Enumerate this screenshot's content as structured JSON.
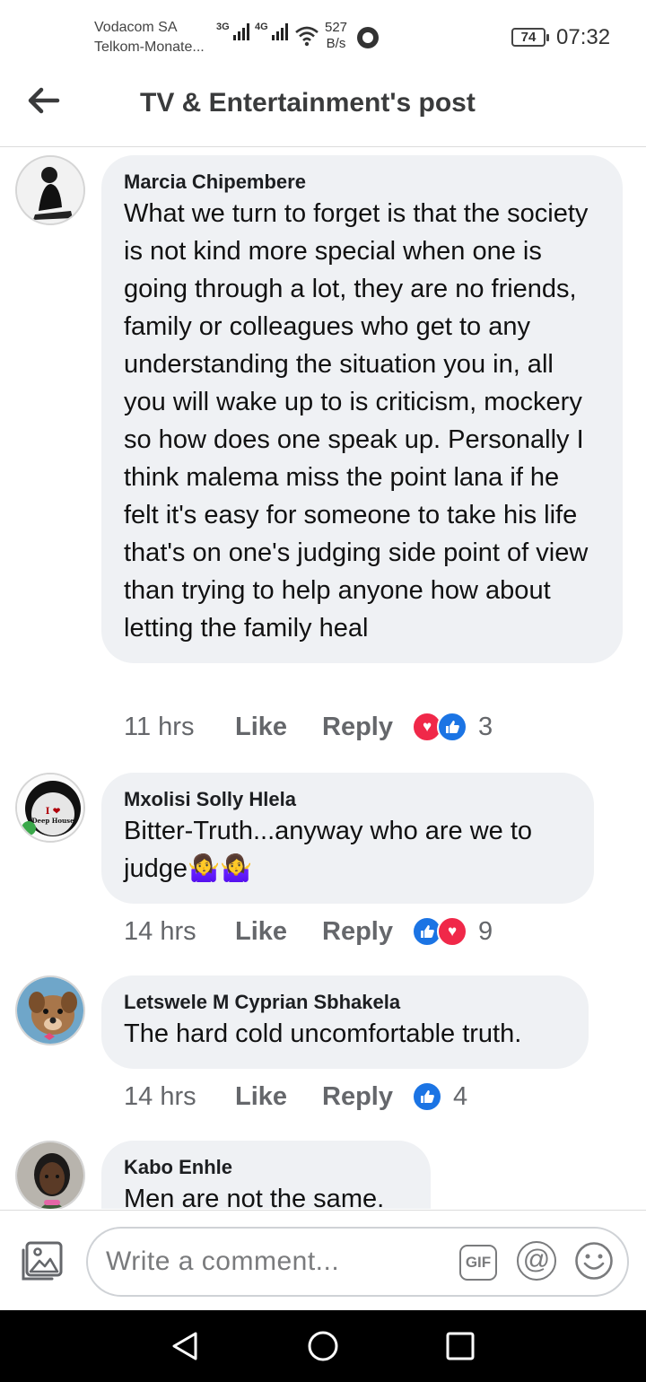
{
  "status_bar": {
    "carrier_1": "Vodacom SA",
    "carrier_2": "Telkom-Monate...",
    "network_1": "3G",
    "network_2": "4G",
    "speed_value": "527",
    "speed_unit": "B/s",
    "battery": "74",
    "time": "07:32",
    "icons": [
      "signal-icon",
      "wifi-icon",
      "whatsapp-icon",
      "battery-icon"
    ]
  },
  "header": {
    "title": "TV & Entertainment's post",
    "back_icon": "arrow-left-icon"
  },
  "comments": [
    {
      "author": "Marcia Chipembere",
      "text": "What we turn to forget is that the society is not kind more special when one is going through a lot, they are no friends, family or colleagues who get to any understanding the situation you in, all you will wake up to is criticism, mockery so how does one speak up. Personally I think malema miss the point lana if he felt it's easy for someone to take his life that's on one's judging side point of view than trying to help anyone how about letting the family heal",
      "time": "11 hrs",
      "like_label": "Like",
      "reply_label": "Reply",
      "reactions": [
        "love",
        "like"
      ],
      "reaction_count": "3"
    },
    {
      "author": "Mxolisi Solly Hlela",
      "text": "Bitter-Truth...anyway who are we to judge🤷‍♀️🤷‍♀️",
      "time": "14 hrs",
      "like_label": "Like",
      "reply_label": "Reply",
      "reactions": [
        "like",
        "love"
      ],
      "reaction_count": "9",
      "avatar_text_1": "I ❤",
      "avatar_text_2": "Deep House"
    },
    {
      "author": "Letswele M Cyprian Sbhakela",
      "text": "The hard cold uncomfortable truth.",
      "time": "14 hrs",
      "like_label": "Like",
      "reply_label": "Reply",
      "reactions": [
        "like"
      ],
      "reaction_count": "4"
    },
    {
      "author": "Kabo Enhle",
      "text": "Men are not the same."
    }
  ],
  "composer": {
    "placeholder": "Write a comment...",
    "gif_label": "GIF",
    "at_label": "@",
    "icons": [
      "photo-icon",
      "gif-icon",
      "at-icon",
      "emoji-icon"
    ]
  },
  "nav": {
    "icons": [
      "back-triangle-icon",
      "home-circle-icon",
      "recents-square-icon"
    ]
  },
  "colors": {
    "bubble": "#eff1f4",
    "like_blue": "#1b74e4",
    "love_red": "#f02849",
    "meta_gray": "#65676b"
  }
}
